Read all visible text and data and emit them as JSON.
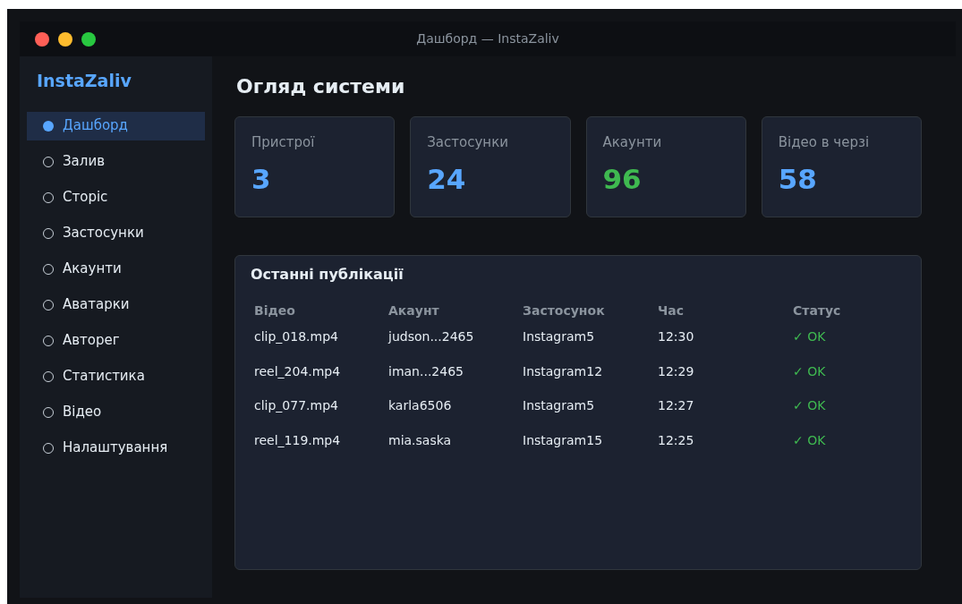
{
  "window": {
    "title": "Дашборд — InstaZaliv"
  },
  "sidebar": {
    "brand": "InstaZaliv",
    "items": [
      {
        "label": "Дашборд",
        "selected": true
      },
      {
        "label": "Залив",
        "selected": false
      },
      {
        "label": "Сторіс",
        "selected": false
      },
      {
        "label": "Застосунки",
        "selected": false
      },
      {
        "label": "Акаунти",
        "selected": false
      },
      {
        "label": "Аватарки",
        "selected": false
      },
      {
        "label": "Авторег",
        "selected": false
      },
      {
        "label": "Статистика",
        "selected": false
      },
      {
        "label": "Відео",
        "selected": false
      },
      {
        "label": "Налаштування",
        "selected": false
      }
    ]
  },
  "heading": "Огляд системи",
  "stats": [
    {
      "label": "Пристрої",
      "value": "3",
      "color": "#58a6ff"
    },
    {
      "label": "Застосунки",
      "value": "24",
      "color": "#58a6ff"
    },
    {
      "label": "Акаунти",
      "value": "96",
      "color": "#3fb950"
    },
    {
      "label": "Відео в черзі",
      "value": "58",
      "color": "#58a6ff"
    }
  ],
  "recent": {
    "title": "Останні публікації",
    "columns": [
      "Відео",
      "Акаунт",
      "Застосунок",
      "Час",
      "Статус"
    ],
    "rows": [
      [
        "clip_018.mp4",
        "judson...2465",
        "Instagram5",
        "12:30",
        "✓ OK"
      ],
      [
        "reel_204.mp4",
        "iman...2465",
        "Instagram12",
        "12:29",
        "✓ OK"
      ],
      [
        "clip_077.mp4",
        "karla6506",
        "Instagram5",
        "12:27",
        "✓ OK"
      ],
      [
        "reel_119.mp4",
        "mia.saska",
        "Instagram15",
        "12:25",
        "✓ OK"
      ]
    ]
  }
}
